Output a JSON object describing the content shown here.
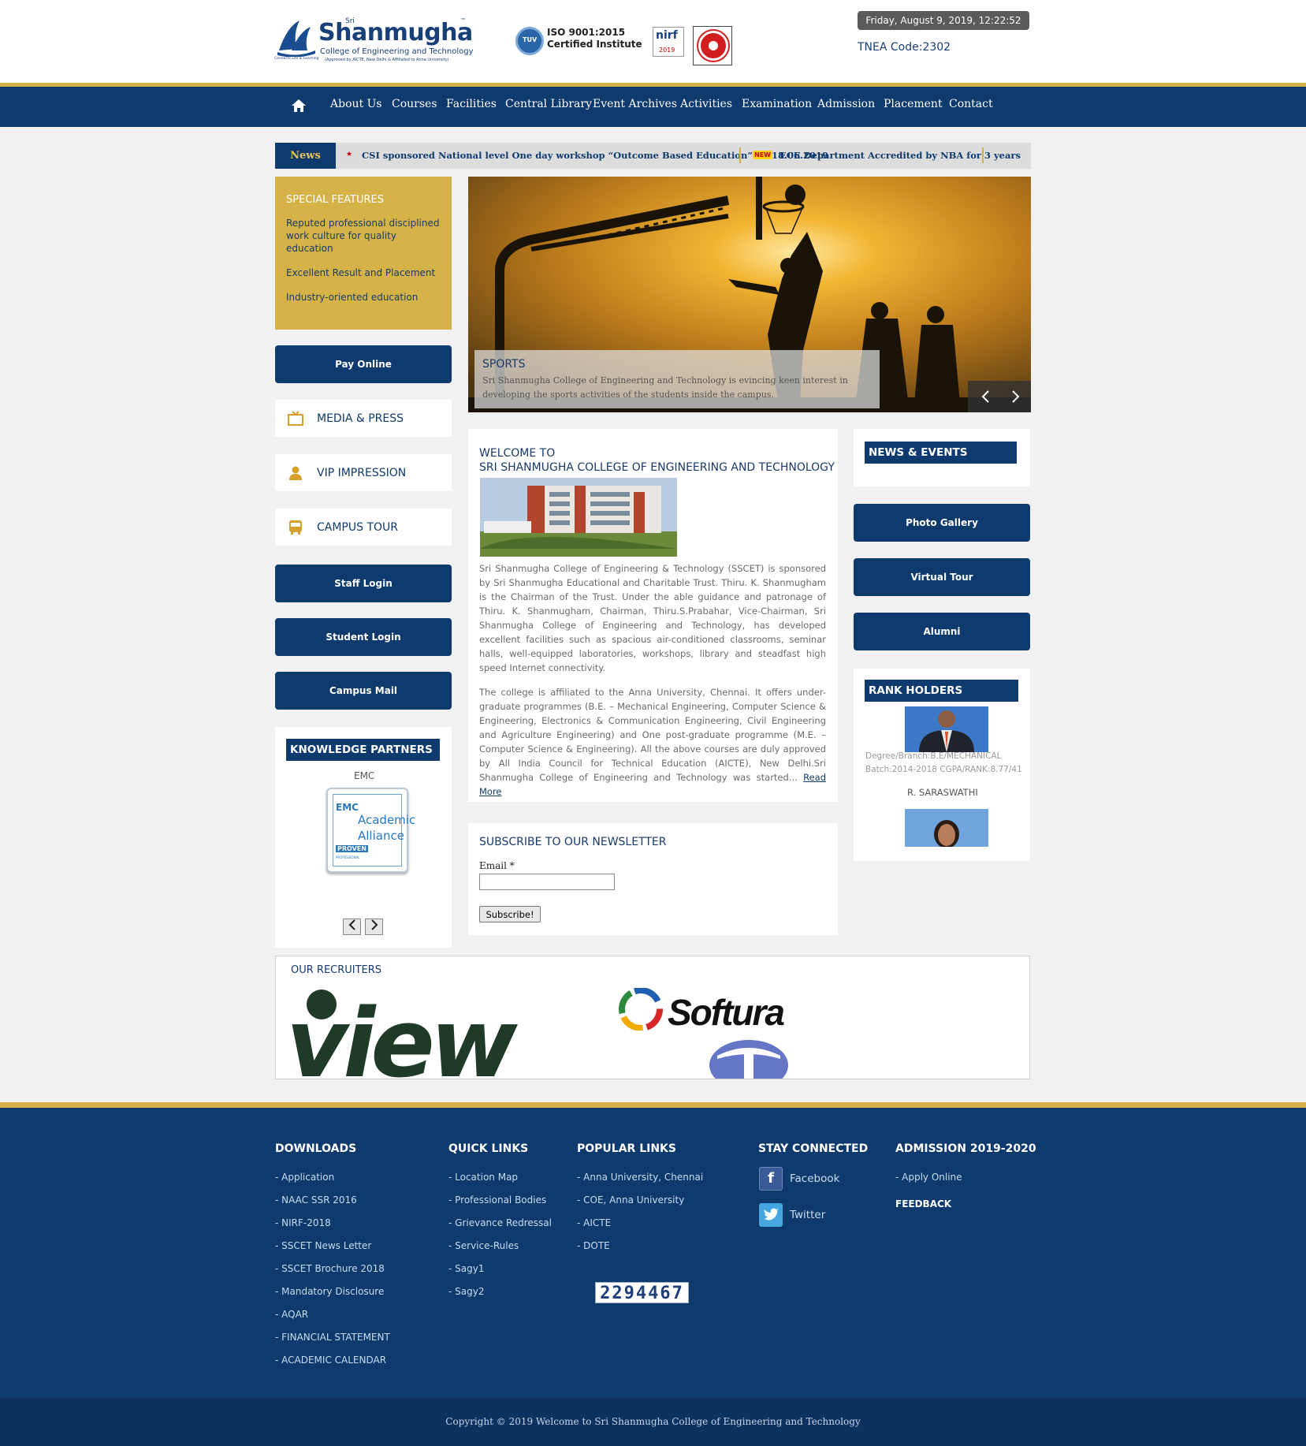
{
  "header": {
    "logo": {
      "sri": "Sri",
      "name": "Shanmugha",
      "subtitle": "College of Engineering and Technology",
      "approval": "(Approved by AICTE, New Delhi & Affiliated to Anna University)",
      "tagline": "Connects Life & Learning"
    },
    "iso": {
      "line1": "ISO 9001:2015",
      "line2": "Certified Institute",
      "badge": "TUV"
    },
    "nirf": {
      "name": "nirf",
      "year": "2019"
    },
    "datetime": "Friday, August 9, 2019, 12:22:52 PM",
    "tnea": "TNEA Code:2302"
  },
  "nav": {
    "items": [
      "About Us",
      "Courses",
      "Facilities",
      "Central Library",
      "Event Archives",
      "Activities",
      "Examination",
      "Admission",
      "Placement",
      "Contact"
    ]
  },
  "news": {
    "label": "News",
    "items": [
      "CSI sponsored National level One day workshop “Outcome Based Education” on 18.06.2019",
      "ECE Department Accredited by NBA for 3 years"
    ],
    "badge": "NEW"
  },
  "special": {
    "title": "SPECIAL FEATURES",
    "items": [
      "Reputed professional disciplined work culture for quality education",
      "Excellent Result and Placement",
      "Industry-oriented education"
    ]
  },
  "left_buttons": {
    "pay": "Pay Online",
    "media": "MEDIA & PRESS",
    "vip": "VIP IMPRESSION",
    "campus": "CAMPUS TOUR",
    "staff": "Staff Login",
    "student": "Student Login",
    "mail": "Campus Mail"
  },
  "knowledge": {
    "title": "KNOWLEDGE PARTNERS",
    "partner": "EMC",
    "logo_line1": "EMC",
    "logo_line2": "Academic",
    "logo_line3": "Alliance",
    "logo_line4": "PROVEN",
    "logo_line5": "PROFESSIONAL"
  },
  "slider": {
    "title": "SPORTS",
    "text": "Sri Shanmugha College of Engineering and Technology is evincing keen interest in developing the sports activities of the students inside the campus."
  },
  "welcome": {
    "line1": "WELCOME TO",
    "line2": "SRI SHANMUGHA COLLEGE OF ENGINEERING AND TECHNOLOGY",
    "para1": "Sri Shanmugha College of Engineering & Technology (SSCET) is sponsored by Sri Shanmugha Educational and Charitable Trust. Thiru. K. Shanmugham is the Chairman of the Trust. Under the able guidance and patronage of Thiru. K. Shanmugham, Chairman, Thiru.S.Prabahar, Vice-Chairman, Sri Shanmugha College of Engineering and Technology, has developed excellent facilities such as spacious air-conditioned classrooms, seminar halls, well-equipped laboratories, workshops, library and steadfast high speed Internet connectivity.",
    "para2": "The college is affiliated to the Anna University, Chennai. It offers under-graduate programmes (B.E. – Mechanical Engineering, Computer Science & Engineering, Electronics & Communication Engineering, Civil Engineering and Agriculture Engineering) and One post-graduate programme (M.E. – Computer Science & Engineering). All the above courses are duly approved by All India Council for Technical Education (AICTE), New Delhi.Sri Shanmugha College of Engineering and Technology was started...",
    "read_more": "Read More"
  },
  "newsletter": {
    "title": "SUBSCRIBE TO OUR NEWSLETTER",
    "email_label": "Email *",
    "email_value": "",
    "button": "Subscribe!"
  },
  "right": {
    "news_events": "NEWS & EVENTS",
    "photo": "Photo Gallery",
    "virtual": "Virtual Tour",
    "alumni": "Alumni",
    "rank_title": "RANK HOLDERS",
    "rank_detail1": "Degree/Branch:B.E/MECHANICAL",
    "rank_detail2": "Batch:2014-2018 CGPA/RANK:8.77/41",
    "rank_name": "R. SARASWATHI"
  },
  "recruiters": {
    "title": "OUR RECRUITERS",
    "logo1": "view",
    "logo2": "Softura"
  },
  "footer": {
    "downloads": {
      "title": "DOWNLOADS",
      "items": [
        "- Application",
        "- NAAC SSR 2016",
        "- NIRF-2018",
        "- SSCET News Letter",
        "- SSCET Brochure 2018",
        "- Mandatory Disclosure",
        "- AQAR",
        "- FINANCIAL STATEMENT",
        "- ACADEMIC CALENDAR"
      ]
    },
    "quick": {
      "title": "QUICK LINKS",
      "items": [
        "- Location Map",
        "- Professional Bodies",
        "- Grievance Redressal",
        "- Service-Rules",
        "- Sagy1",
        "- Sagy2"
      ]
    },
    "popular": {
      "title": "POPULAR LINKS",
      "items": [
        "- Anna University, Chennai",
        "- COE, Anna University",
        "- AICTE",
        "- DOTE"
      ]
    },
    "counter": "2294467",
    "stay": {
      "title": "STAY CONNECTED",
      "facebook": "Facebook",
      "twitter": "Twitter"
    },
    "admission": {
      "title": "ADMISSION 2019-2020",
      "apply": "- Apply Online",
      "feedback": "FEEDBACK"
    },
    "copyright": "Copyright © 2019 Welcome to Sri Shanmugha College of Engineering and Technology"
  },
  "colors": {
    "navy": "#0e3a6d",
    "gold": "#d5b248",
    "background": "#f1f1f1"
  }
}
